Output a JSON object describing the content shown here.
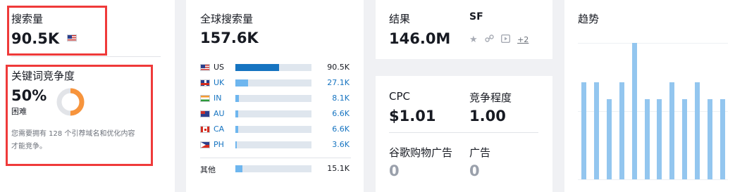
{
  "volume": {
    "label": "搜索量",
    "value": "90.5K",
    "flag": "us-flag"
  },
  "difficulty": {
    "label": "关键词竞争度",
    "percent_text": "50%",
    "percent": 50,
    "level": "困难",
    "description_line1": "您需要拥有 128 个引荐域名和优化内容",
    "description_line2": "才能竞争。",
    "colors": {
      "filled": "#f7943c",
      "empty": "#e2e4e8"
    }
  },
  "global": {
    "label": "全球搜索量",
    "value": "157.6K",
    "countries": [
      {
        "flag": "us-flag",
        "code": "US",
        "value": "90.5K",
        "share": 0.57
      },
      {
        "flag": "uk-flag",
        "code": "UK",
        "value": "27.1K",
        "share": 0.17
      },
      {
        "flag": "in-flag",
        "code": "IN",
        "value": "8.1K",
        "share": 0.05
      },
      {
        "flag": "au-flag",
        "code": "AU",
        "value": "6.6K",
        "share": 0.04
      },
      {
        "flag": "ca-flag",
        "code": "CA",
        "value": "6.6K",
        "share": 0.04
      },
      {
        "flag": "ph-flag",
        "code": "PH",
        "value": "3.6K",
        "share": 0.02
      }
    ],
    "other": {
      "label": "其他",
      "value": "15.1K",
      "share": 0.09
    }
  },
  "results": {
    "label": "结果",
    "value": "146.0M",
    "sf_label": "SF",
    "sf_icons": [
      "star-icon",
      "link-icon",
      "video-icon"
    ],
    "sf_more": "+2"
  },
  "ppc": {
    "cpc_label": "CPC",
    "cpc_value": "$1.01",
    "competition_label": "竞争程度",
    "competition_value": "1.00",
    "shopping_label": "谷歌购物广告",
    "shopping_value": "0",
    "ads_label": "广告",
    "ads_value": "0"
  },
  "trend": {
    "label": "趋势",
    "values": [
      0.71,
      0.71,
      0.59,
      0.71,
      1.0,
      0.59,
      0.59,
      0.71,
      0.59,
      0.71,
      0.59,
      0.59
    ]
  },
  "colors": {
    "accent": "#1674c1",
    "highlight": "#ef3a3a",
    "bar": "#6eb6ef",
    "trend": "#93c6ef"
  }
}
